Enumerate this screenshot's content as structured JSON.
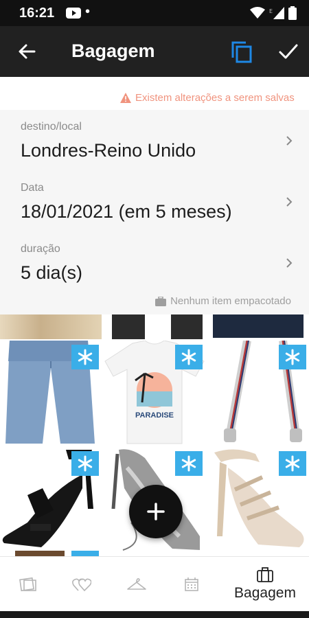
{
  "status_bar": {
    "time": "16:21"
  },
  "app_bar": {
    "title": "Bagagem"
  },
  "warning": {
    "text": "Existem alterações a serem salvas"
  },
  "details": {
    "fields": [
      {
        "label": "destino/local",
        "value": "Londres-Reino Unido"
      },
      {
        "label": "Data",
        "value": "18/01/2021 (em 5 meses)"
      },
      {
        "label": "duração",
        "value": "5 dia(s)"
      }
    ],
    "packed_note": "Nenhum item empacotado"
  },
  "items": [
    {
      "icon": "jeans"
    },
    {
      "icon": "paradise-tshirt",
      "print": "PARADISE"
    },
    {
      "icon": "striped-strap"
    },
    {
      "icon": "black-sandal"
    },
    {
      "icon": "silver-sandal"
    },
    {
      "icon": "gold-sandal"
    }
  ],
  "bottom_nav": {
    "items": [
      {
        "icon": "wardrobe-icon"
      },
      {
        "icon": "hearts-icon"
      },
      {
        "icon": "hanger-icon"
      },
      {
        "icon": "calendar-icon"
      },
      {
        "icon": "suitcase-icon",
        "label": "Bagagem"
      }
    ]
  },
  "colors": {
    "app_bar": "#212121",
    "accent_blue": "#1e88e5",
    "badge_blue": "#3aaee8",
    "warning": "#f0937e",
    "details_bg": "#f6f6f6"
  }
}
